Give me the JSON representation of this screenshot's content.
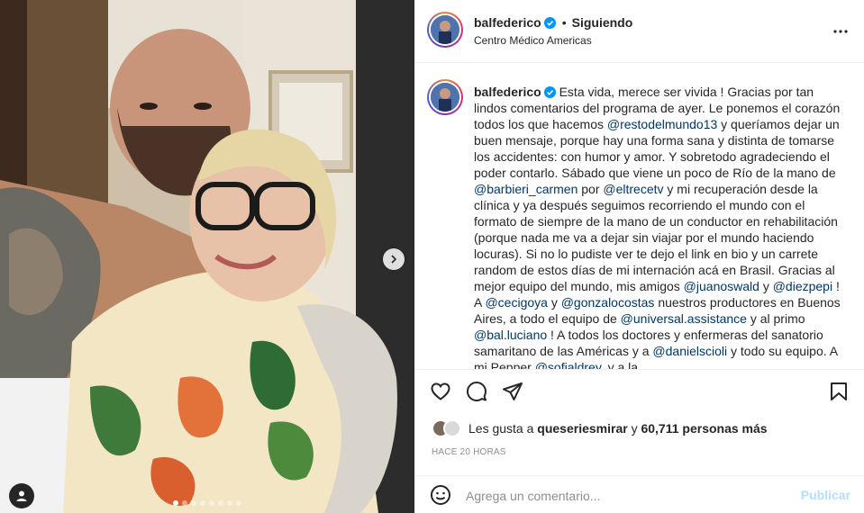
{
  "header": {
    "username": "balfederico",
    "bullet": "•",
    "follow_state": "Siguiendo",
    "location": "Centro Médico Americas"
  },
  "caption": {
    "username": "balfederico",
    "parts": [
      {
        "t": "Esta vida, merece ser vivida ! Gracias por tan lindos comentarios del programa de ayer. Le ponemos el corazón todos los que hacemos "
      },
      {
        "m": "@restodelmundo13"
      },
      {
        "t": " y queríamos dejar un buen mensaje, porque hay una forma sana y distinta de tomarse los accidentes: con humor y amor. Y sobretodo agradeciendo el poder contarlo. Sábado que viene un poco de Río de la mano de "
      },
      {
        "m": "@barbieri_carmen"
      },
      {
        "t": " por "
      },
      {
        "m": "@eltrecetv"
      },
      {
        "t": " y mi recuperación desde la clínica y ya después seguimos recorriendo el mundo con el formato de siempre de la mano de un conductor en rehabilitación (porque nada me va a dejar sin viajar por el mundo haciendo locuras). Si no lo pudiste ver te dejo el link en bio y un carrete random de estos días de mi internación acá en Brasil. Gracias al mejor equipo del mundo, mis amigos "
      },
      {
        "m": "@juanoswald"
      },
      {
        "t": " y "
      },
      {
        "m": "@diezpepi"
      },
      {
        "t": " ! A "
      },
      {
        "m": "@cecigoya"
      },
      {
        "t": " y "
      },
      {
        "m": "@gonzalocostas"
      },
      {
        "t": " nuestros productores en Buenos Aires, a todo el equipo de "
      },
      {
        "m": "@universal.assistance"
      },
      {
        "t": " y al primo "
      },
      {
        "m": "@bal.luciano"
      },
      {
        "t": " ! A todos los doctores y enfermeras del sanatorio samaritano de las Américas y a "
      },
      {
        "m": "@danielscioli"
      },
      {
        "t": " y todo su equipo. A mi Pepper "
      },
      {
        "m": "@sofialdrey"
      },
      {
        "t": ", y a la"
      }
    ]
  },
  "actions": {
    "icons": [
      "heart-icon",
      "comment-icon",
      "share-icon",
      "bookmark-icon"
    ]
  },
  "likes": {
    "prefix": "Les gusta a ",
    "user": "queseriesmirar",
    "middle": " y ",
    "count_text": "60,711 personas más"
  },
  "timestamp": "HACE 20 HORAS",
  "comment": {
    "placeholder": "Agrega un comentario...",
    "publish_label": "Publicar"
  },
  "carousel": {
    "total": 8,
    "active_index": 0
  },
  "colors": {
    "mention": "#00376b",
    "publish_disabled": "#b2dffc",
    "verified": "#0095f6",
    "muted": "#8e8e8e"
  }
}
